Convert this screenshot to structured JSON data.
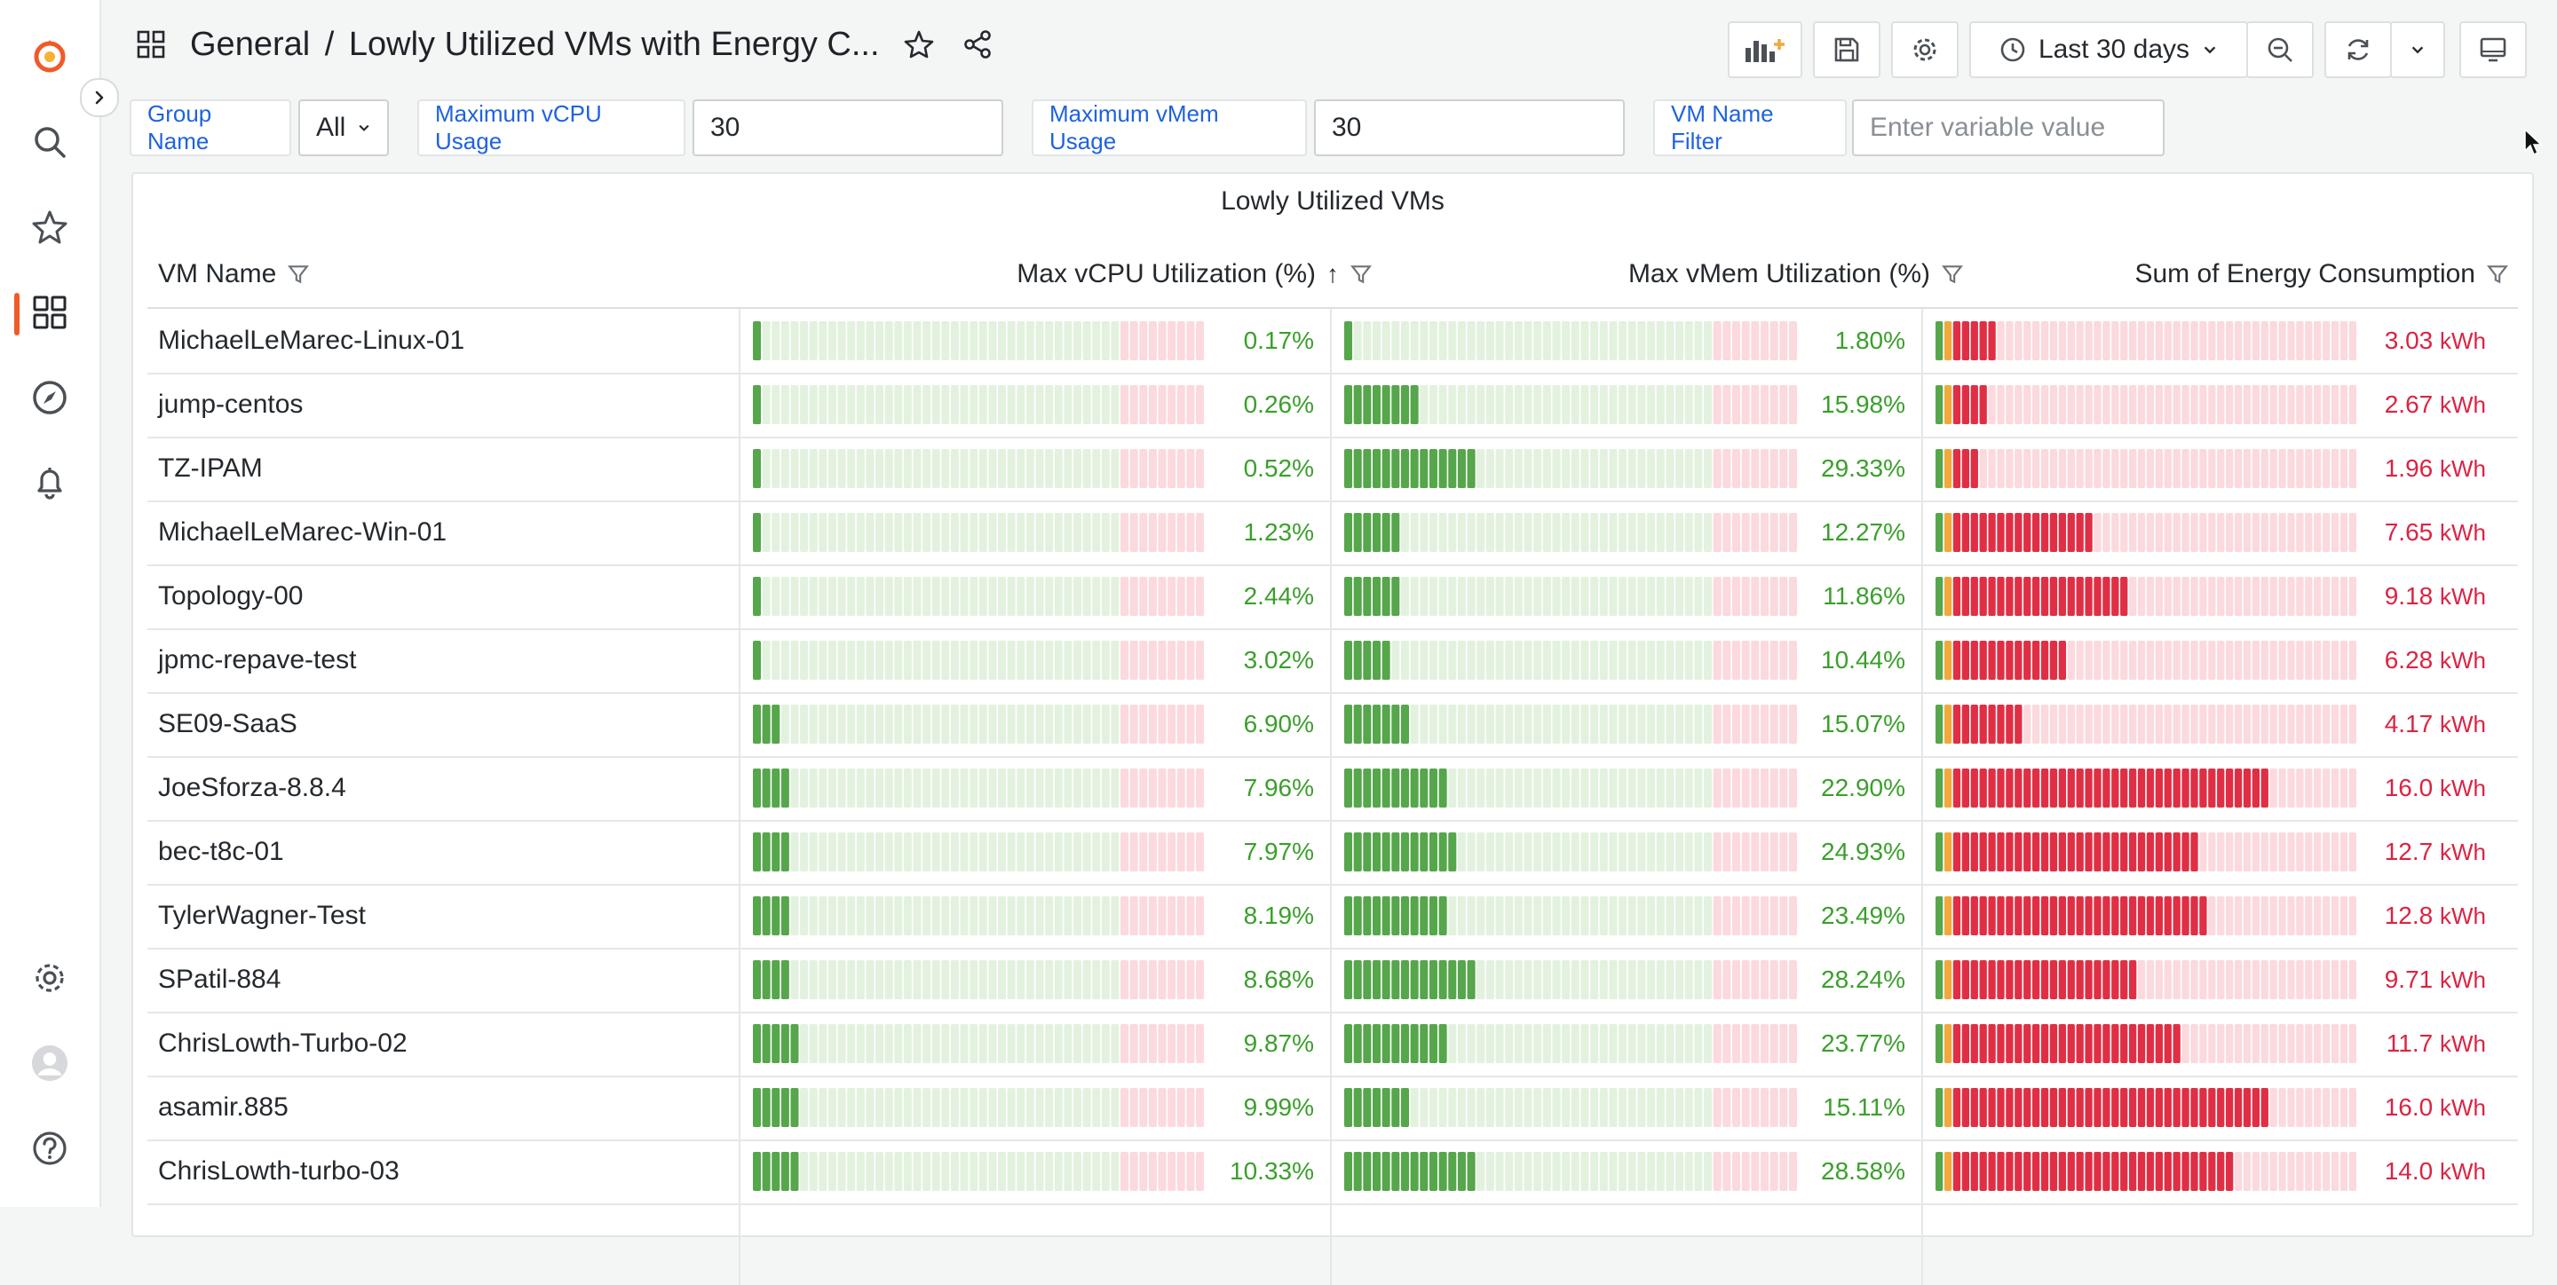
{
  "header": {
    "folder": "General",
    "separator": "/",
    "dashboard_title": "Lowly Utilized VMs with Energy C...",
    "time_range": "Last 30 days"
  },
  "variables": {
    "group_name_label": "Group Name",
    "group_name_value": "All",
    "max_vcpu_label": "Maximum vCPU Usage",
    "max_vcpu_value": "30",
    "max_vmem_label": "Maximum vMem Usage",
    "max_vmem_value": "30",
    "vm_filter_label": "VM Name Filter",
    "vm_filter_placeholder": "Enter variable value"
  },
  "panel": {
    "title": "Lowly Utilized VMs",
    "columns": {
      "vm_name": "VM Name",
      "vcpu": "Max vCPU Utilization (%)",
      "vmem": "Max vMem Utilization (%)",
      "energy": "Sum of Energy Consumption"
    },
    "sort_indicator": "↑",
    "energy_unit": "kWh",
    "rows": [
      {
        "name": "MichaelLeMarec-Linux-01",
        "vcpu": 0.17,
        "vcpu_text": "0.17%",
        "vmem": 1.8,
        "vmem_text": "1.80%",
        "energy": 3.03,
        "energy_text": "3.03"
      },
      {
        "name": "jump-centos",
        "vcpu": 0.26,
        "vcpu_text": "0.26%",
        "vmem": 15.98,
        "vmem_text": "15.98%",
        "energy": 2.67,
        "energy_text": "2.67"
      },
      {
        "name": "TZ-IPAM",
        "vcpu": 0.52,
        "vcpu_text": "0.52%",
        "vmem": 29.33,
        "vmem_text": "29.33%",
        "energy": 1.96,
        "energy_text": "1.96"
      },
      {
        "name": "MichaelLeMarec-Win-01",
        "vcpu": 1.23,
        "vcpu_text": "1.23%",
        "vmem": 12.27,
        "vmem_text": "12.27%",
        "energy": 7.65,
        "energy_text": "7.65"
      },
      {
        "name": "Topology-00",
        "vcpu": 2.44,
        "vcpu_text": "2.44%",
        "vmem": 11.86,
        "vmem_text": "11.86%",
        "energy": 9.18,
        "energy_text": "9.18"
      },
      {
        "name": "jpmc-repave-test",
        "vcpu": 3.02,
        "vcpu_text": "3.02%",
        "vmem": 10.44,
        "vmem_text": "10.44%",
        "energy": 6.28,
        "energy_text": "6.28"
      },
      {
        "name": "SE09-SaaS",
        "vcpu": 6.9,
        "vcpu_text": "6.90%",
        "vmem": 15.07,
        "vmem_text": "15.07%",
        "energy": 4.17,
        "energy_text": "4.17"
      },
      {
        "name": "JoeSforza-8.8.4",
        "vcpu": 7.96,
        "vcpu_text": "7.96%",
        "vmem": 22.9,
        "vmem_text": "22.90%",
        "energy": 16.0,
        "energy_text": "16.0"
      },
      {
        "name": "bec-t8c-01",
        "vcpu": 7.97,
        "vcpu_text": "7.97%",
        "vmem": 24.93,
        "vmem_text": "24.93%",
        "energy": 12.7,
        "energy_text": "12.7"
      },
      {
        "name": "TylerWagner-Test",
        "vcpu": 8.19,
        "vcpu_text": "8.19%",
        "vmem": 23.49,
        "vmem_text": "23.49%",
        "energy": 12.8,
        "energy_text": "12.8"
      },
      {
        "name": "SPatil-884",
        "vcpu": 8.68,
        "vcpu_text": "8.68%",
        "vmem": 28.24,
        "vmem_text": "28.24%",
        "energy": 9.71,
        "energy_text": "9.71"
      },
      {
        "name": "ChrisLowth-Turbo-02",
        "vcpu": 9.87,
        "vcpu_text": "9.87%",
        "vmem": 23.77,
        "vmem_text": "23.77%",
        "energy": 11.7,
        "energy_text": "11.7"
      },
      {
        "name": "asamir.885",
        "vcpu": 9.99,
        "vcpu_text": "9.99%",
        "vmem": 15.11,
        "vmem_text": "15.11%",
        "energy": 16.0,
        "energy_text": "16.0"
      },
      {
        "name": "ChrisLowth-turbo-03",
        "vcpu": 10.33,
        "vcpu_text": "10.33%",
        "vmem": 28.58,
        "vmem_text": "28.58%",
        "energy": 14.0,
        "energy_text": "14.0"
      }
    ]
  },
  "colors": {
    "accent": "#f05a28",
    "link_blue": "#1f62e0",
    "gauge_green": "#56a64b",
    "gauge_green_dim": "#e3f1df",
    "gauge_red": "#e02f44",
    "gauge_red_dim": "#fbd9dd",
    "gauge_orange": "#f2a93b",
    "value_green": "#3a9f2b",
    "value_red": "#dc2343"
  },
  "icons": [
    "grafana-logo-icon",
    "search-icon",
    "star-icon",
    "dashboards-icon",
    "explore-icon",
    "alerting-icon",
    "settings-icon",
    "user-avatar-icon",
    "help-icon",
    "chevron-right-icon",
    "grid-icon",
    "star-outline-icon",
    "share-icon",
    "add-panel-icon",
    "save-icon",
    "gear-icon",
    "clock-icon",
    "chevron-down-icon",
    "zoom-out-icon",
    "refresh-icon",
    "tv-mode-icon",
    "filter-icon",
    "sort-arrow-icon"
  ]
}
